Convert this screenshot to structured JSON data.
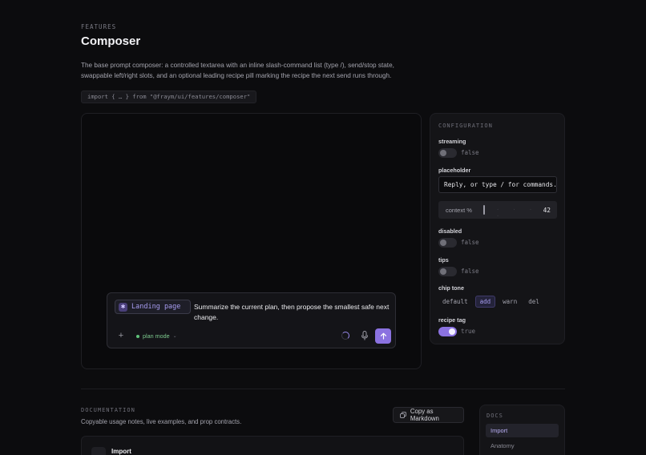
{
  "header": {
    "eyebrow": "FEATURES",
    "title": "Composer",
    "description": "The base prompt composer: a controlled textarea with an inline slash-command list (type /), send/stop state, swappable left/right slots, and an optional leading recipe pill marking the recipe the next send runs through.",
    "import_code": "import { … } from \"@fraym/ui/features/composer\""
  },
  "composer": {
    "recipe_label": "Landing page",
    "text": "Summarize the current plan, then propose the smallest safe next change.",
    "plus": "+",
    "mode_label": "plan mode",
    "mode_chevron": "⌄",
    "icons": [
      "plus-icon",
      "spinner-icon",
      "mic-icon",
      "send-arrow-icon"
    ]
  },
  "config": {
    "title": "CONFIGURATION",
    "streaming": {
      "label": "streaming",
      "value": "false"
    },
    "placeholder": {
      "label": "placeholder",
      "value": "Reply, or type / for commands."
    },
    "context": {
      "label": "context %",
      "ticks": "· · · · ·",
      "value": "42"
    },
    "disabled": {
      "label": "disabled",
      "value": "false"
    },
    "tips": {
      "label": "tips",
      "value": "false"
    },
    "chip_tone": {
      "label": "chip tone",
      "options": [
        "default",
        "add",
        "warn",
        "del"
      ],
      "selected": "add"
    },
    "recipe_tag": {
      "label": "recipe tag",
      "value": "true"
    },
    "accent": "#8b72e0"
  },
  "documentation": {
    "eyebrow": "DOCUMENTATION",
    "subtitle": "Copyable usage notes, live examples, and prop contracts.",
    "copy_label": "Copy as Markdown",
    "card_title": "Import"
  },
  "docs_nav": {
    "title": "DOCS",
    "items": [
      {
        "label": "Import"
      },
      {
        "label": "Anatomy"
      }
    ]
  }
}
